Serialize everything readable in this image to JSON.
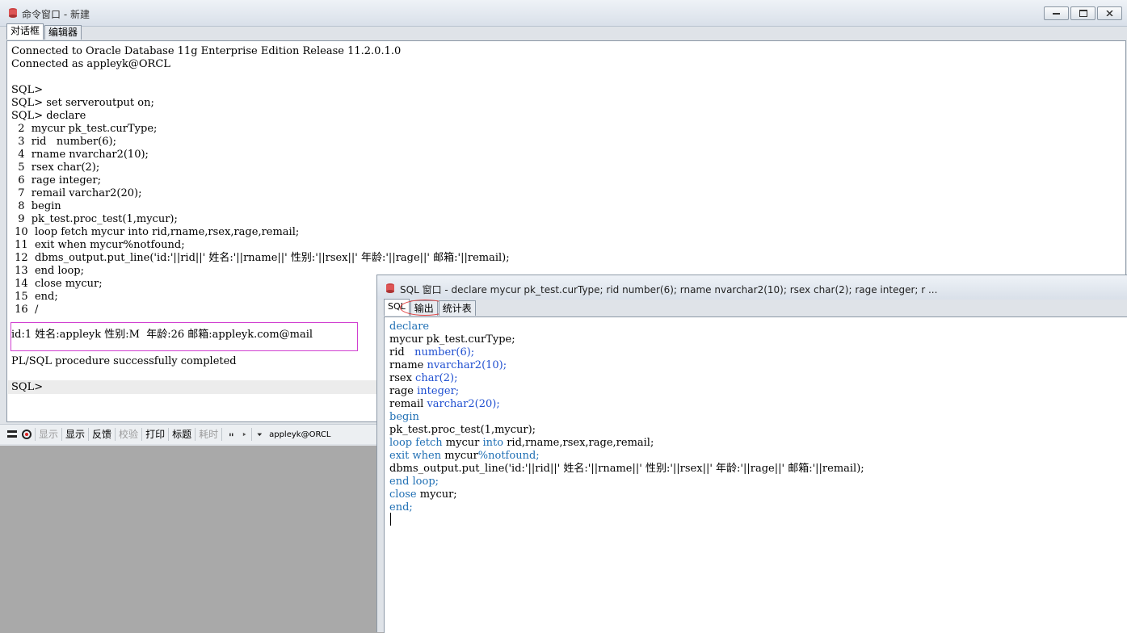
{
  "main_window": {
    "title": "命令窗口 - 新建",
    "tabs": [
      "对话框",
      "编辑器"
    ],
    "console_lines": [
      "Connected to Oracle Database 11g Enterprise Edition Release 11.2.0.1.0",
      "Connected as appleyk@ORCL",
      "",
      "SQL>",
      "SQL> set serveroutput on;",
      "SQL> declare",
      "  2  mycur pk_test.curType;",
      "  3  rid   number(6);",
      "  4  rname nvarchar2(10);",
      "  5  rsex char(2);",
      "  6  rage integer;",
      "  7  remail varchar2(20);",
      "  8  begin",
      "  9  pk_test.proc_test(1,mycur);",
      " 10  loop fetch mycur into rid,rname,rsex,rage,remail;",
      " 11  exit when mycur%notfound;",
      " 12  dbms_output.put_line('id:'||rid||' 姓名:'||rname||' 性别:'||rsex||' 年龄:'||rage||' 邮箱:'||remail);",
      " 13  end loop;",
      " 14  close mycur;",
      " 15  end;",
      " 16  /"
    ],
    "result_line": "id:1 姓名:appleyk 性别:M  年龄:26 邮箱:appleyk.com@mail",
    "completed_line": "PL/SQL procedure successfully completed",
    "prompt": "SQL>",
    "toolbar": {
      "items": [
        {
          "label": "显示",
          "enabled": false
        },
        {
          "label": "显示",
          "enabled": true
        },
        {
          "label": "反馈",
          "enabled": true
        },
        {
          "label": "校验",
          "enabled": false
        },
        {
          "label": "打印",
          "enabled": true
        },
        {
          "label": "标题",
          "enabled": true
        },
        {
          "label": "耗时",
          "enabled": false
        }
      ],
      "connection": "appleyk@ORCL"
    }
  },
  "sql_window": {
    "title": "SQL 窗口 - declare mycur pk_test.curType; rid number(6); rname nvarchar2(10); rsex char(2); rage integer; r ...",
    "tabs": [
      "SQL",
      "输出",
      "统计表"
    ],
    "code_lines": [
      [
        {
          "t": "declare",
          "c": "kw"
        }
      ],
      [
        {
          "t": "mycur pk_test.curType;",
          "c": ""
        }
      ],
      [
        {
          "t": "rid   ",
          "c": ""
        },
        {
          "t": "number(6);",
          "c": "ty"
        }
      ],
      [
        {
          "t": "rname ",
          "c": ""
        },
        {
          "t": "nvarchar2(10);",
          "c": "ty"
        }
      ],
      [
        {
          "t": "rsex ",
          "c": ""
        },
        {
          "t": "char(2);",
          "c": "ty"
        }
      ],
      [
        {
          "t": "rage ",
          "c": ""
        },
        {
          "t": "integer;",
          "c": "ty"
        }
      ],
      [
        {
          "t": "remail ",
          "c": ""
        },
        {
          "t": "varchar2(20);",
          "c": "ty"
        }
      ],
      [
        {
          "t": "begin",
          "c": "kw"
        }
      ],
      [
        {
          "t": "pk_test.proc_test(1,mycur);",
          "c": ""
        }
      ],
      [
        {
          "t": "loop fetch",
          "c": "kw"
        },
        {
          "t": " mycur ",
          "c": ""
        },
        {
          "t": "into",
          "c": "kw"
        },
        {
          "t": " rid,rname,rsex,rage,remail;",
          "c": ""
        }
      ],
      [
        {
          "t": "exit when",
          "c": "kw"
        },
        {
          "t": " mycur",
          "c": ""
        },
        {
          "t": "%notfound;",
          "c": "kw"
        }
      ],
      [
        {
          "t": "dbms_output.put_line('id:'||rid||' 姓名:'||rname||' 性别:'||rsex||' 年龄:'||rage||' 邮箱:'||remail);",
          "c": ""
        }
      ],
      [
        {
          "t": "end loop;",
          "c": "kw"
        }
      ],
      [
        {
          "t": "close",
          "c": "kw"
        },
        {
          "t": " mycur;",
          "c": ""
        }
      ],
      [
        {
          "t": "end;",
          "c": "kw"
        }
      ]
    ]
  },
  "colors": {
    "keyword": "#1f6fb4",
    "result_border": "#d040d0",
    "tab_highlight": "#e04040"
  }
}
